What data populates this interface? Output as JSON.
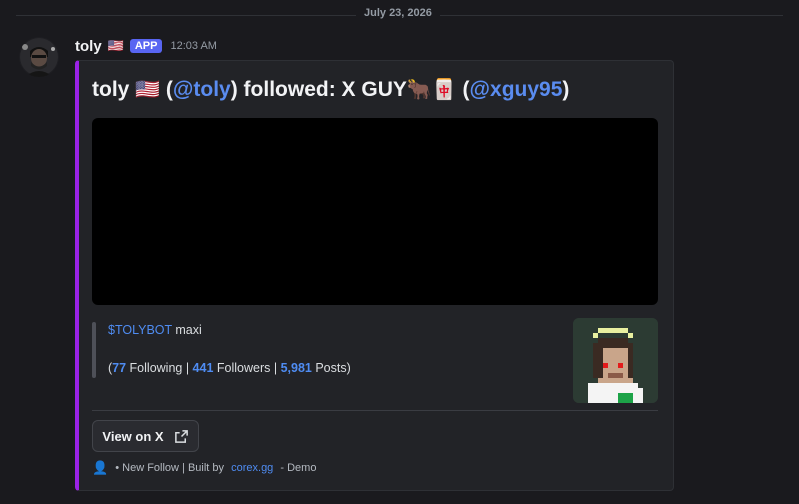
{
  "divider": {
    "date": "July 23, 2026"
  },
  "message": {
    "username": "toly",
    "flag": "🇺🇸",
    "badge": "APP",
    "timestamp": "12:03 AM"
  },
  "embed": {
    "accent_color": "#9a22e6",
    "title": {
      "name": "toly",
      "flag": "🇺🇸",
      "open_paren": " (",
      "handle": "@toly",
      "mid": ") followed: X GUY",
      "emoji_ox": "🐂",
      "emoji_tile": "🀄",
      "open_paren2": " (",
      "handle2": "@xguy95",
      "close_paren": ")"
    },
    "description": {
      "link": "$TOLYBOT",
      "suffix": " maxi",
      "open": "(",
      "following_count": "77",
      "following_label": " Following | ",
      "followers_count": "441",
      "followers_label": " Followers | ",
      "posts_count": "5,981",
      "posts_label": " Posts)"
    },
    "button_label": "View on X",
    "footer": {
      "icon": "👤",
      "text": " • New Follow | Built by ",
      "link": "corex.gg",
      "suffix": " - Demo"
    }
  },
  "icons": {
    "avatar": "user-avatar",
    "external": "external-link-icon",
    "thumbnail": "pixel-art-avatar"
  }
}
